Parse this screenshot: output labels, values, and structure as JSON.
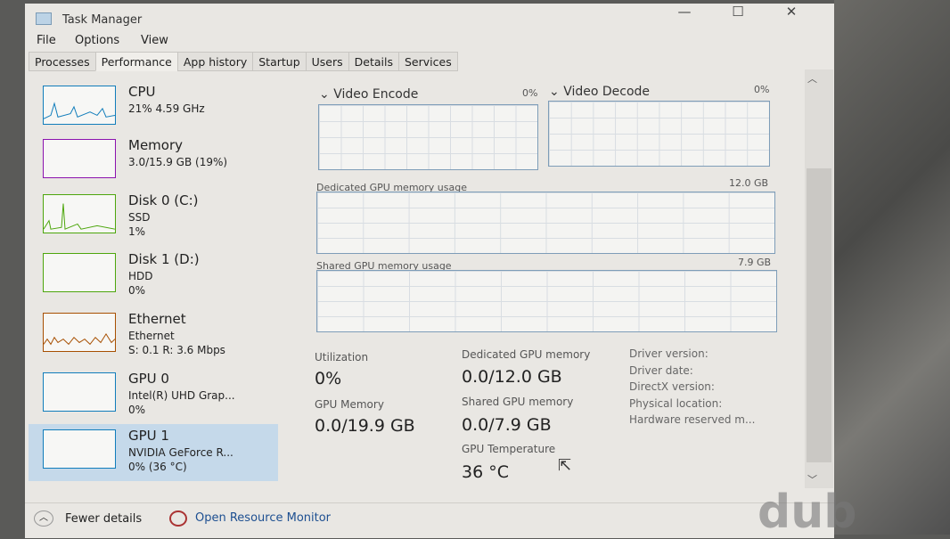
{
  "window": {
    "title": "Task Manager",
    "minimize": "—",
    "maximize": "☐",
    "close": "✕"
  },
  "menu": [
    "File",
    "Options",
    "View"
  ],
  "tabs": [
    "Processes",
    "Performance",
    "App history",
    "Startup",
    "Users",
    "Details",
    "Services"
  ],
  "active_tab": "Performance",
  "sidebar": [
    {
      "name": "CPU",
      "l1": "21% 4.59 GHz",
      "l2": "",
      "color": "#117dbb"
    },
    {
      "name": "Memory",
      "l1": "3.0/15.9 GB (19%)",
      "l2": "",
      "color": "#8b12ae"
    },
    {
      "name": "Disk 0 (C:)",
      "l1": "SSD",
      "l2": "1%",
      "color": "#4da60c"
    },
    {
      "name": "Disk 1 (D:)",
      "l1": "HDD",
      "l2": "0%",
      "color": "#4da60c"
    },
    {
      "name": "Ethernet",
      "l1": "Ethernet",
      "l2": "S: 0.1  R: 3.6 Mbps",
      "color": "#a74f01"
    },
    {
      "name": "GPU 0",
      "l1": "Intel(R) UHD Grap...",
      "l2": "0%",
      "color": "#117dbb"
    },
    {
      "name": "GPU 1",
      "l1": "NVIDIA GeForce R...",
      "l2": "0% (36 °C)",
      "color": "#117dbb"
    }
  ],
  "selected_item": "GPU 1",
  "main": {
    "video_encode": {
      "label": "Video Encode",
      "value": "0%"
    },
    "video_decode": {
      "label": "Video Decode",
      "value": "0%"
    },
    "dedicated_graph": {
      "label": "Dedicated GPU memory usage",
      "max": "12.0 GB"
    },
    "shared_graph": {
      "label": "Shared GPU memory usage",
      "max": "7.9 GB"
    },
    "stats": {
      "utilization_label": "Utilization",
      "utilization": "0%",
      "gpu_memory_label": "GPU Memory",
      "gpu_memory": "0.0/19.9 GB",
      "dedicated_label": "Dedicated GPU memory",
      "dedicated": "0.0/12.0 GB",
      "shared_label": "Shared GPU memory",
      "shared": "0.0/7.9 GB",
      "temp_label": "GPU Temperature",
      "temp": "36 °C"
    },
    "info": [
      "Driver version:",
      "Driver date:",
      "DirectX version:",
      "Physical location:",
      "Hardware reserved m..."
    ]
  },
  "footer": {
    "fewer": "Fewer details",
    "monitor": "Open Resource Monitor"
  },
  "watermark": "dub"
}
